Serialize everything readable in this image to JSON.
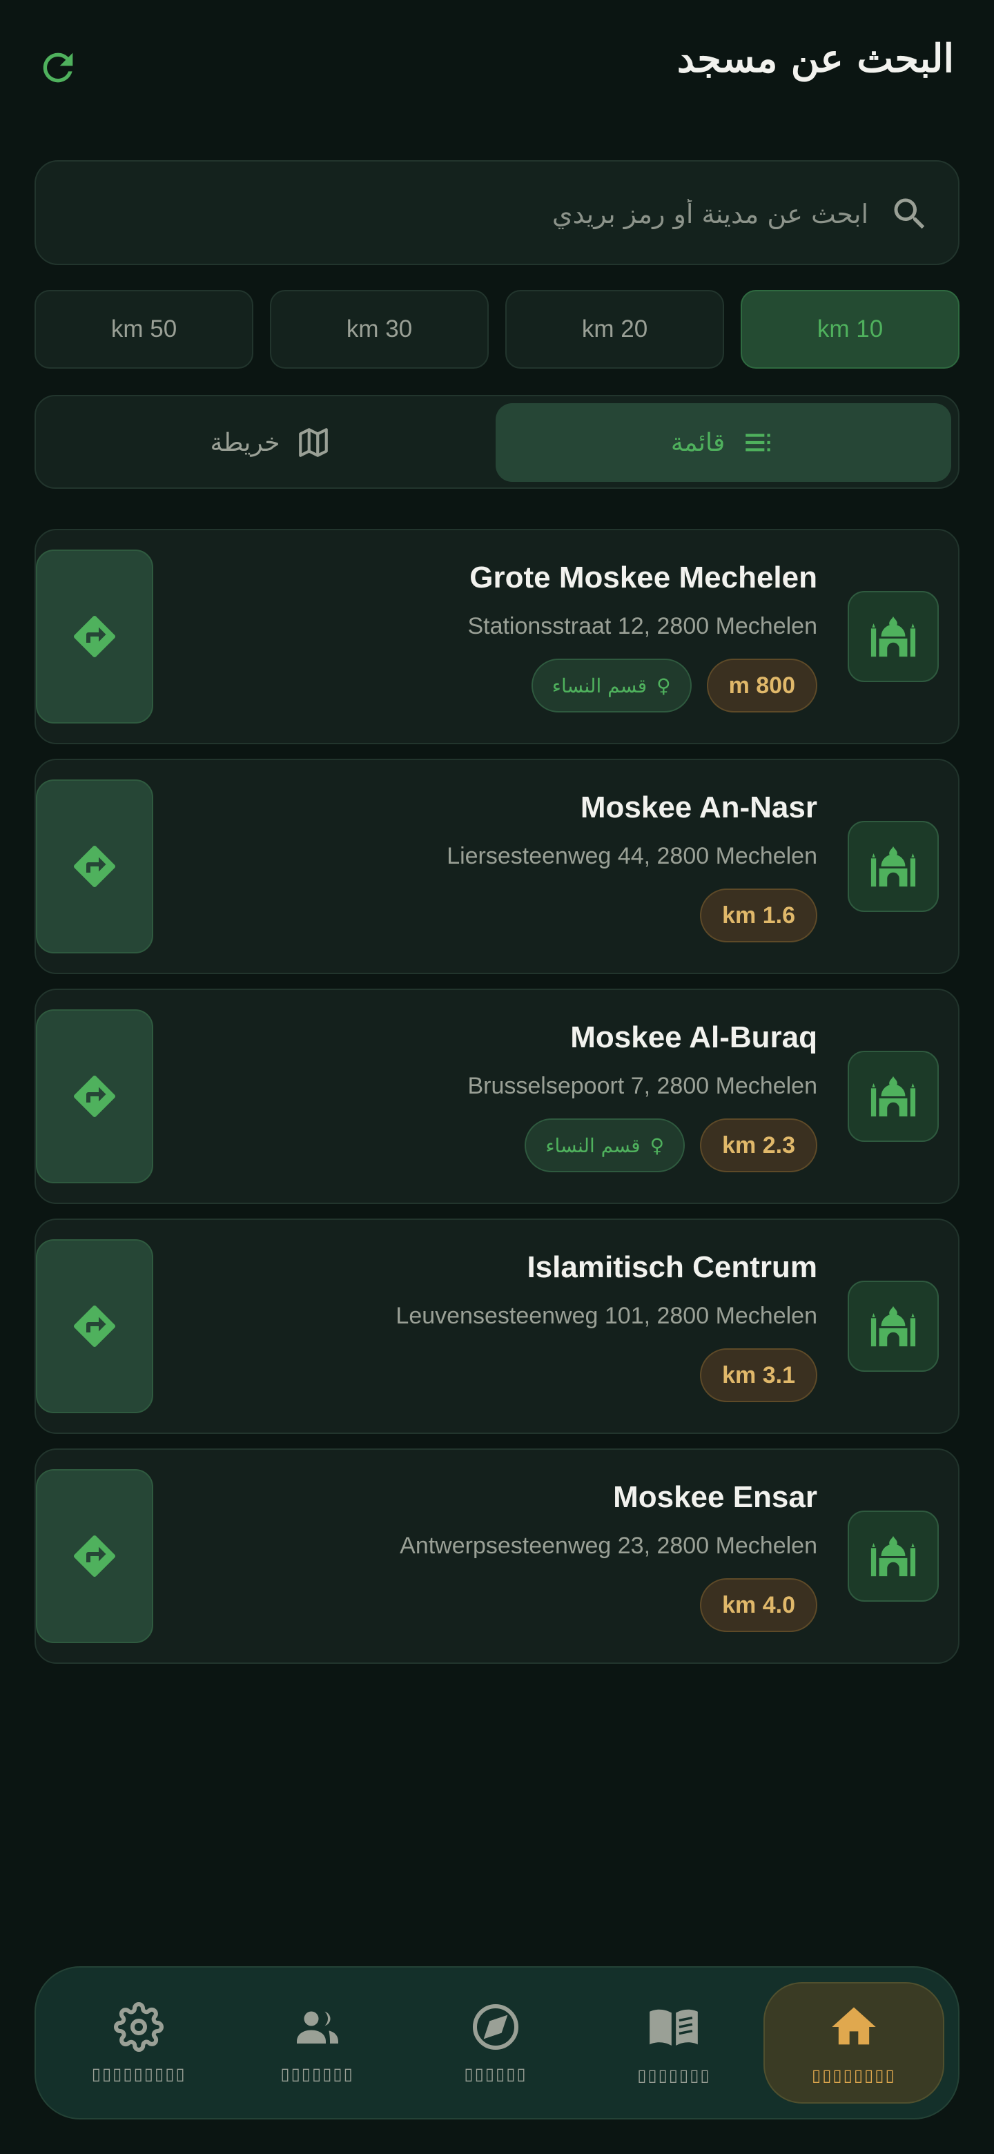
{
  "header": {
    "title": "البحث عن مسجد",
    "refresh_icon": "refresh-icon"
  },
  "search": {
    "placeholder": "ابحث عن مدينة أو رمز بريدي",
    "value": ""
  },
  "radius_options": [
    {
      "label": "km 50",
      "active": false
    },
    {
      "label": "km 30",
      "active": false
    },
    {
      "label": "km 20",
      "active": false
    },
    {
      "label": "km 10",
      "active": true
    }
  ],
  "view_toggle": {
    "map_label": "خريطة",
    "list_label": "قائمة",
    "selected": "list"
  },
  "mosques": [
    {
      "name": "Grote Moskee Mechelen",
      "address": "Stationsstraat 12, 2800 Mechelen",
      "distance": "m 800",
      "women_section": true,
      "women_label": "قسم النساء"
    },
    {
      "name": "Moskee An-Nasr",
      "address": "Liersesteenweg 44, 2800 Mechelen",
      "distance": "km 1.6",
      "women_section": false
    },
    {
      "name": "Moskee Al-Buraq",
      "address": "Brusselsepoort 7, 2800 Mechelen",
      "distance": "km 2.3",
      "women_section": true,
      "women_label": "قسم النساء"
    },
    {
      "name": "Islamitisch Centrum",
      "address": "Leuvensesteenweg 101, 2800 Mechelen",
      "distance": "km 3.1",
      "women_section": false
    },
    {
      "name": "Moskee Ensar",
      "address": "Antwerpsesteenweg 23, 2800 Mechelen",
      "distance": "km 4.0",
      "women_section": false
    }
  ],
  "bottom_nav": {
    "items": [
      {
        "icon": "gear-icon",
        "label": "▯▯▯▯▯▯▯▯▯",
        "active": false
      },
      {
        "icon": "people-icon",
        "label": "▯▯▯▯▯▯▯",
        "active": false
      },
      {
        "icon": "compass-icon",
        "label": "▯▯▯▯▯▯",
        "active": false
      },
      {
        "icon": "book-icon",
        "label": "▯▯▯▯▯▯▯",
        "active": false
      },
      {
        "icon": "home-icon",
        "label": "▯▯▯▯▯▯▯▯",
        "active": true
      }
    ]
  },
  "colors": {
    "background": "#0b1512",
    "accent_green": "#4fb15d",
    "accent_amber": "#e0a84e",
    "distance_text": "#e0b86a"
  }
}
